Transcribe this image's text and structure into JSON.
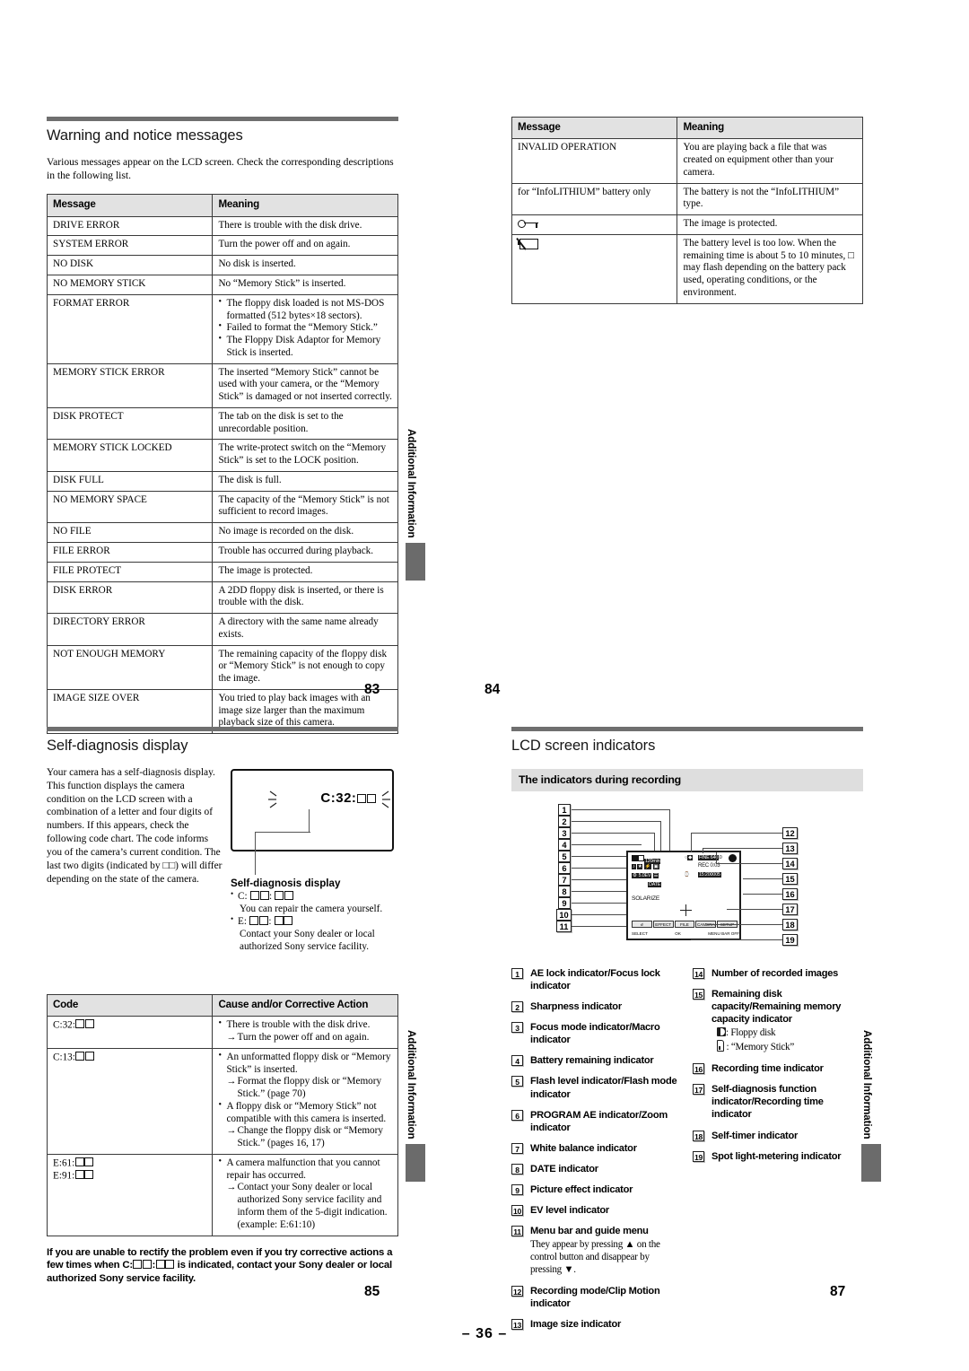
{
  "page83": {
    "title": "Warning and notice messages",
    "intro": "Various messages appear on the LCD screen. Check the corresponding descriptions in the following list.",
    "table": {
      "headers": [
        "Message",
        "Meaning"
      ],
      "rows": [
        {
          "message": "DRIVE ERROR",
          "meaning": "There is trouble with the disk drive."
        },
        {
          "message": "SYSTEM ERROR",
          "meaning": "Turn the power off and on again."
        },
        {
          "message": "NO DISK",
          "meaning": "No disk is inserted."
        },
        {
          "message": "NO MEMORY STICK",
          "meaning": "No “Memory Stick” is inserted."
        },
        {
          "message": "FORMAT ERROR",
          "meaning": "",
          "bullets": [
            "The floppy disk loaded is not MS-DOS formatted (512 bytes×18 sectors).",
            "Failed to format the “Memory Stick.”",
            "The Floppy Disk Adaptor for Memory Stick is inserted."
          ]
        },
        {
          "message": "MEMORY STICK ERROR",
          "meaning": "The inserted “Memory Stick” cannot be used with your camera, or the “Memory Stick” is damaged or not inserted correctly."
        },
        {
          "message": "DISK PROTECT",
          "meaning": "The tab on the disk is set to the unrecordable position."
        },
        {
          "message": "MEMORY STICK LOCKED",
          "meaning": "The write-protect switch on the “Memory Stick” is set to the LOCK position."
        },
        {
          "message": "DISK FULL",
          "meaning": "The disk is full."
        },
        {
          "message": "NO MEMORY SPACE",
          "meaning": "The capacity of the “Memory Stick” is not sufficient to record images."
        },
        {
          "message": "NO FILE",
          "meaning": "No image is recorded on the disk."
        },
        {
          "message": "FILE ERROR",
          "meaning": "Trouble has occurred during playback."
        },
        {
          "message": "FILE PROTECT",
          "meaning": "The image is protected."
        },
        {
          "message": "DISK ERROR",
          "meaning": "A 2DD floppy disk is inserted, or there is trouble with the disk."
        },
        {
          "message": "DIRECTORY ERROR",
          "meaning": "A directory with the same name already exists."
        },
        {
          "message": "NOT ENOUGH MEMORY",
          "meaning": "The remaining capacity of the floppy disk or “Memory Stick” is not enough to copy the image."
        },
        {
          "message": "IMAGE SIZE OVER",
          "meaning": "You tried to play back images with an image size larger than the maximum playback size of this camera."
        }
      ]
    },
    "side_tab": "Additional Information",
    "page_number": "83"
  },
  "page84": {
    "table": {
      "headers": [
        "Message",
        "Meaning"
      ],
      "rows": [
        {
          "message": "INVALID OPERATION",
          "meaning": "You are playing back a file that was created on equipment other than your camera."
        },
        {
          "message": "for “InfoLITHIUM” battery only",
          "meaning": "The battery is not the “InfoLITHIUM” type."
        },
        {
          "message": "",
          "icon": "key-icon",
          "meaning": "The image is protected."
        },
        {
          "message": "",
          "icon": "low-battery-icon",
          "meaning": "The battery level is too low. When the remaining time is about 5 to 10 minutes, □ may flash depending on the battery pack used, operating conditions, or the environment."
        }
      ]
    },
    "page_number": "84"
  },
  "page85": {
    "title": "Self-diagnosis display",
    "intro": "Your camera has a self-diagnosis display. This function displays the camera condition on the LCD screen with a combination of a letter and four digits of numbers. If this appears, check the following code chart. The code informs you of the camera’s current condition. The last two digits (indicated by □□) will differ depending on the state of the camera.",
    "lcd_code": "C:32:",
    "caption": {
      "title": "Self-diagnosis display",
      "item_c_code": "C:",
      "item_c_text": "You can repair the camera yourself.",
      "item_e_code": "E:",
      "item_e_text": "Contact your Sony dealer or local authorized Sony service facility."
    },
    "table": {
      "headers": [
        "Code",
        "Cause and/or Corrective Action"
      ],
      "rows": [
        {
          "code": "C:32:",
          "code_suffix_boxes": 2,
          "bullets": [
            {
              "text": "There is trouble with the disk drive.",
              "arrow": "Turn the power off and on again."
            }
          ]
        },
        {
          "code": "C:13:",
          "code_suffix_boxes": 2,
          "bullets": [
            {
              "text": "An unformatted floppy disk or “Memory Stick” is inserted.",
              "arrow": "Format the floppy disk or “Memory Stick.” (page 70)"
            },
            {
              "text": "A floppy disk or “Memory Stick” not compatible with this camera is inserted.",
              "arrow": "Change the floppy disk or “Memory Stick.” (pages 16, 17)"
            }
          ]
        },
        {
          "code": "E:61:",
          "code2": "E:91:",
          "code_suffix_boxes": 2,
          "bullets": [
            {
              "text": "A camera malfunction that you cannot repair has occurred.",
              "arrow": "Contact your Sony dealer or local authorized Sony service facility and inform them of the 5-digit indication. (example: E:61:10)"
            }
          ]
        }
      ]
    },
    "note_pre": "If you are unable to rectify the problem even if you try corrective actions a few times when C:",
    "note_mid": ":",
    "note_post": " is indicated, contact your Sony dealer or local authorized Sony service facility.",
    "side_tab": "Additional Information",
    "page_number": "85"
  },
  "page87": {
    "title": "LCD screen indicators",
    "subhead": "The indicators during recording",
    "diagram": {
      "left_numbers": [
        "1",
        "2",
        "3",
        "4",
        "5",
        "6",
        "7",
        "8",
        "9",
        "10",
        "11"
      ],
      "right_numbers": [
        "12",
        "13",
        "14",
        "15",
        "16",
        "17",
        "18",
        "19"
      ],
      "lcd_texts": {
        "battery_time": "120min",
        "image_count": "10",
        "rec_time": "REC 0:03",
        "file_number": "15:200005",
        "effect": "SOLARIZE",
        "ev": "5.0EV",
        "menu_items": [
          "EFFECT",
          "FILE",
          "CAMERA",
          "SETUP"
        ],
        "guide_select": "SELECT",
        "guide_ok": "OK",
        "guide_menu": "MENU BAR OFF"
      }
    },
    "legend_left": [
      {
        "num": "1",
        "label": "AE lock indicator/Focus lock indicator"
      },
      {
        "num": "2",
        "label": "Sharpness indicator"
      },
      {
        "num": "3",
        "label": "Focus mode indicator/Macro indicator"
      },
      {
        "num": "4",
        "label": "Battery remaining indicator"
      },
      {
        "num": "5",
        "label": "Flash level indicator/Flash mode indicator"
      },
      {
        "num": "6",
        "label": "PROGRAM AE indicator/Zoom indicator"
      },
      {
        "num": "7",
        "label": "White balance indicator"
      },
      {
        "num": "8",
        "label": "DATE indicator"
      },
      {
        "num": "9",
        "label": "Picture effect indicator"
      },
      {
        "num": "10",
        "label": "EV level indicator"
      },
      {
        "num": "11",
        "label": "Menu bar and guide menu",
        "note": "They appear by pressing ▲ on the control button and disappear by pressing ▼."
      },
      {
        "num": "12",
        "label": "Recording mode/Clip Motion indicator"
      },
      {
        "num": "13",
        "label": "Image size indicator"
      }
    ],
    "legend_right": [
      {
        "num": "14",
        "label": "Number of recorded images"
      },
      {
        "num": "15",
        "label": "Remaining disk capacity/Remaining memory capacity indicator",
        "icon_rows": [
          {
            "icon": "floppy-disk-icon",
            "text": ": Floppy disk"
          },
          {
            "icon": "memory-stick-icon",
            "text": ": “Memory Stick”"
          }
        ]
      },
      {
        "num": "16",
        "label": "Recording time indicator"
      },
      {
        "num": "17",
        "label": "Self-diagnosis function indicator/Recording time indicator"
      },
      {
        "num": "18",
        "label": "Self-timer indicator"
      },
      {
        "num": "19",
        "label": "Spot light-metering indicator"
      }
    ],
    "side_tab": "Additional Information",
    "page_number": "87"
  },
  "sheet": {
    "number": "– 36 –"
  }
}
